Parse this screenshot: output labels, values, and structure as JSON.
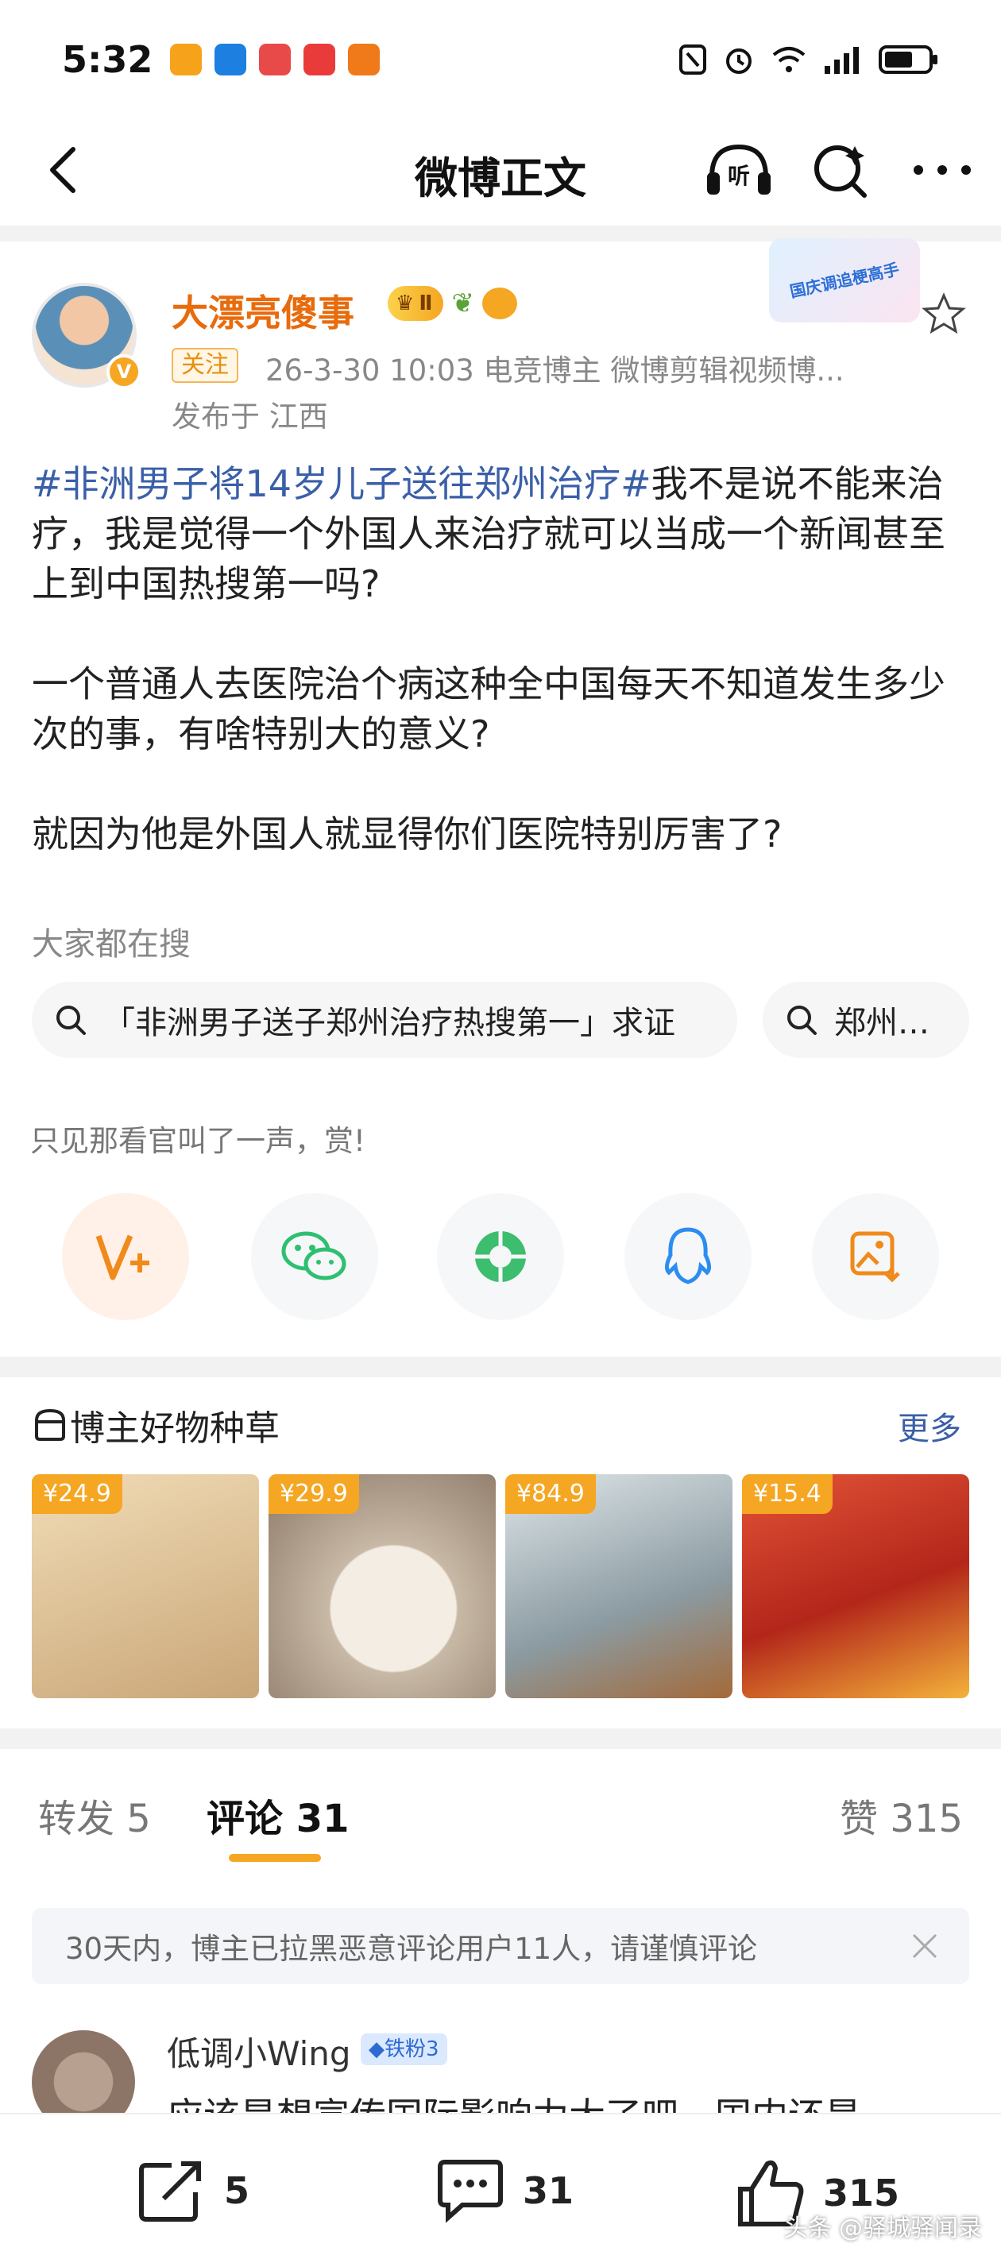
{
  "status_bar": {
    "time": "5:32"
  },
  "nav": {
    "title": "微博正文"
  },
  "post": {
    "username": "大漂亮傻事",
    "level_badge": "Ⅱ",
    "follow_label": "关注",
    "meta": "26-3-30 10:03  电竞博主 微博剪辑视频博...",
    "location": "发布于 江西",
    "event_badge": "国庆调追梗高手",
    "hashtag": "#非洲男子将14岁儿子送往郑州治疗#",
    "para1_rest": "我不是说不能来治疗，我是觉得一个外国人来治疗就可以当成一个新闻甚至上到中国热搜第一吗?",
    "para2": "一个普通人去医院治个病这种全中国每天不知道发生多少次的事，有啥特别大的意义?",
    "para3": "就因为他是外国人就显得你们医院特别厉害了?"
  },
  "hot_search": {
    "label": "大家都在搜",
    "chips": [
      "「非洲男子送子郑州治疗热搜第一」求证",
      "郑州…"
    ]
  },
  "reward": {
    "text": "只见那看官叫了一声，赏!"
  },
  "share_targets": [
    "vplus-icon",
    "wechat-icon",
    "moments-icon",
    "qq-icon",
    "save-image-icon"
  ],
  "products": {
    "title": "博主好物种草",
    "more": "更多",
    "items": [
      {
        "price": "¥24.9",
        "color": "#e9d2a9"
      },
      {
        "price": "¥29.9",
        "color": "#e8ddd0"
      },
      {
        "price": "¥84.9",
        "color": "#b7c4c9"
      },
      {
        "price": "¥15.4",
        "color": "#d84a2c"
      }
    ]
  },
  "tabs": {
    "repost": "转发 5",
    "comment": "评论 31",
    "like": "赞 315"
  },
  "notice": {
    "text": "30天内，博主已拉黑恶意评论用户11人，请谨慎评论"
  },
  "comment": {
    "user": "低调小Wing",
    "fan_badge": "◆铁粉3",
    "text": "应该是想宣传国际影响力大了吧，国内还是"
  },
  "bottom_bar": {
    "repost_count": "5",
    "comment_count": "31",
    "like_count": "315",
    "watermark": "头条 @驿城驿闻录"
  },
  "colors": {
    "accent": "#f5a623",
    "username": "#e86b0c",
    "link": "#3b5fa8"
  }
}
